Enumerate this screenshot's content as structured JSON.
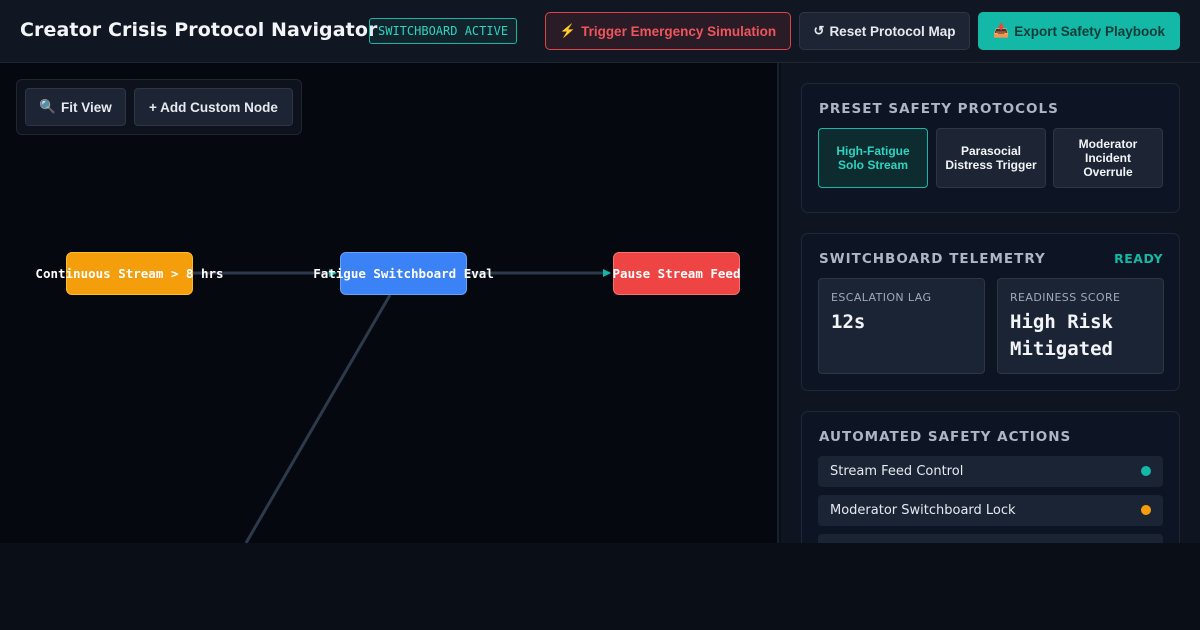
{
  "header": {
    "title": "Creator Crisis Protocol Navigator",
    "status_badge": "SWITCHBOARD ACTIVE",
    "buttons": {
      "trigger_icon": "⚡",
      "trigger": "Trigger Emergency Simulation",
      "reset_icon": "↺",
      "reset": "Reset Protocol Map",
      "export_icon": "📥",
      "export": "Export Safety Playbook"
    }
  },
  "canvas": {
    "toolbar": {
      "fit_icon": "🔍",
      "fit_view": "Fit View",
      "add_node": "+ Add Custom Node"
    },
    "nodes": [
      {
        "label": "Continuous Stream > 8 hrs",
        "color": "#f59e0b"
      },
      {
        "label": "Fatigue Switchboard Eval",
        "color": "#3b82f6"
      },
      {
        "label": "Pause Stream Feed",
        "color": "#ef4444"
      }
    ]
  },
  "panel": {
    "protocols": {
      "title": "PRESET SAFETY PROTOCOLS",
      "items": [
        {
          "label": "High-Fatigue Solo Stream",
          "active": true
        },
        {
          "label": "Parasocial Distress Trigger",
          "active": false
        },
        {
          "label": "Moderator Incident Overrule",
          "active": false
        }
      ]
    },
    "telemetry": {
      "title": "SWITCHBOARD TELEMETRY",
      "status": "READY",
      "metrics": [
        {
          "label": "ESCALATION LAG",
          "value": "12s"
        },
        {
          "label": "READINESS SCORE",
          "value": "High Risk Mitigated"
        }
      ]
    },
    "actions": {
      "title": "AUTOMATED SAFETY ACTIONS",
      "items": [
        {
          "label": "Stream Feed Control",
          "status_color": "#14b8a6"
        },
        {
          "label": "Moderator Switchboard Lock",
          "status_color": "#f59e0b"
        },
        {
          "label": "",
          "status_color": ""
        }
      ]
    }
  },
  "colors": {
    "accent": "#14b8a6",
    "danger": "#ef4444",
    "background": "#0a0e17"
  }
}
